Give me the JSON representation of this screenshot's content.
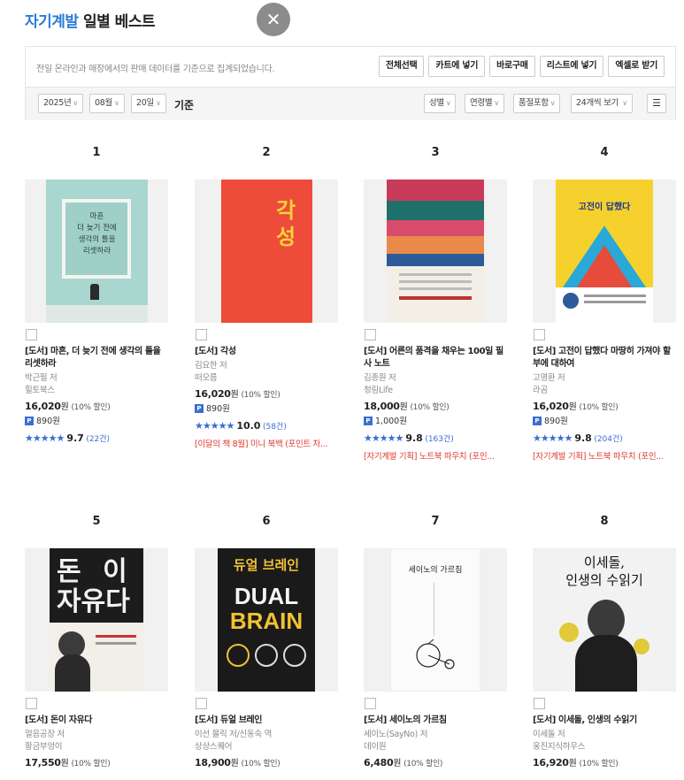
{
  "header": {
    "title_accent": "자기계발",
    "title_rest": "일별 베스트",
    "close_symbol": "✕"
  },
  "toolbar": {
    "description": "전일 온라인과 매장에서의 판매 데이터를 기준으로 집계되었습니다.",
    "buttons": [
      "전체선택",
      "카트에 넣기",
      "바로구매",
      "리스트에 넣기",
      "엑셀로 받기"
    ],
    "year": "2025년",
    "month": "08월",
    "day": "20일",
    "basis": "기준",
    "filters": [
      "성별",
      "연령별",
      "품절포함",
      "24개씩 보기"
    ],
    "list_icon": "☰"
  },
  "books": [
    {
      "rank": "1",
      "title": "[도서] 마흔, 더 늦기 전에 생각의 틀을 리셋하라",
      "author": "박근필 저",
      "publisher": "힐토북스",
      "price": "16,020",
      "price_unit": "원",
      "discount": "(10% 할인)",
      "point": "890원",
      "rating": "9.7",
      "reviews": "(22건)",
      "promo": "",
      "cover_lines": [
        "마흔",
        "더 늦기 전에",
        "생각의 틀을",
        "리셋하라"
      ]
    },
    {
      "rank": "2",
      "title": "[도서] 각성",
      "author": "김요한 저",
      "publisher": "떠오름",
      "price": "16,020",
      "price_unit": "원",
      "discount": "(10% 할인)",
      "point": "890원",
      "rating": "10.0",
      "reviews": "(58건)",
      "promo": "[이달의 책 8월] 미니 북백 (포인트 차...",
      "cover_lines": [
        "각",
        "성"
      ]
    },
    {
      "rank": "3",
      "title": "[도서] 어른의 품격을 채우는 100일 필사 노트",
      "author": "김종원 저",
      "publisher": "청림Life",
      "price": "18,000",
      "price_unit": "원",
      "discount": "(10% 할인)",
      "point": "1,000원",
      "rating": "9.8",
      "reviews": "(163건)",
      "promo": "[자기계발 기획] 노트북 파우치 (포인...",
      "cover_lines": []
    },
    {
      "rank": "4",
      "title": "[도서] 고전이 답했다 마땅히 가져야 할 부에 대하여",
      "author": "고명환 저",
      "publisher": "라곰",
      "price": "16,020",
      "price_unit": "원",
      "discount": "(10% 할인)",
      "point": "890원",
      "rating": "9.8",
      "reviews": "(204건)",
      "promo": "[자기계발 기획] 노트북 파우치 (포인...",
      "cover_lines": [
        "고전이 답했다"
      ]
    },
    {
      "rank": "5",
      "title": "[도서] 돈이 자유다",
      "author": "얼음공장 저",
      "publisher": "황금부엉이",
      "price": "17,550",
      "price_unit": "원",
      "discount": "(10% 할인)",
      "cover_lines": [
        "돈",
        "이",
        "자유다"
      ]
    },
    {
      "rank": "6",
      "title": "[도서] 듀얼 브레인",
      "author": "이선 몰릭 저/신동숙 역",
      "publisher": "상상스퀘어",
      "price": "18,900",
      "price_unit": "원",
      "discount": "(10% 할인)",
      "cover_lines": [
        "듀얼 브레인",
        "DUAL",
        "BRAIN"
      ]
    },
    {
      "rank": "7",
      "title": "[도서] 세이노의 가르침",
      "author": "세이노(SayNo) 저",
      "publisher": "데이원",
      "price": "6,480",
      "price_unit": "원",
      "discount": "(10% 할인)",
      "cover_lines": [
        "세이노의 가르침"
      ]
    },
    {
      "rank": "8",
      "title": "[도서] 이세돌, 인생의 수읽기",
      "author": "이세돌 저",
      "publisher": "웅진지식하우스",
      "price": "16,920",
      "price_unit": "원",
      "discount": "(10% 할인)",
      "cover_lines": [
        "이세돌,",
        "인생의 수읽기"
      ]
    }
  ],
  "star_icon": "★★★★★",
  "point_badge": "P",
  "colors": {
    "accent": "#2b7bd6",
    "rating": "#3a6fd1",
    "promo": "#e0382e"
  }
}
